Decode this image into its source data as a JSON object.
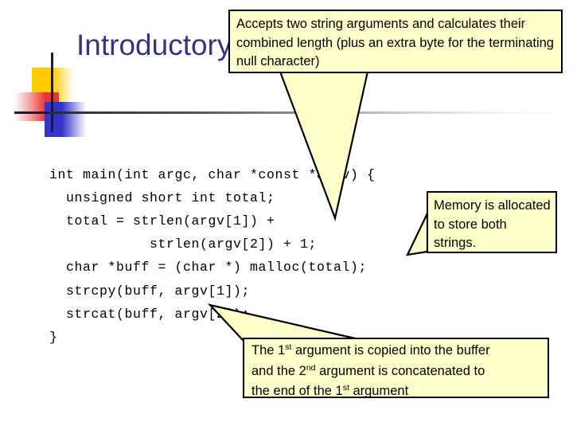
{
  "slide": {
    "title": "Introductory Example",
    "title_color": "#333388",
    "background": "#ffffff"
  },
  "logo": {
    "yellow": "#ffcc00",
    "red": "#ee3333",
    "blue": "#3333cc",
    "bar": "#1b1b33"
  },
  "code": {
    "language": "c",
    "text": "int main(int argc, char *const *argv) {\n  unsigned short int total;\n  total = strlen(argv[1]) +\n            strlen(argv[2]) + 1;\n  char *buff = (char *) malloc(total);\n  strcpy(buff, argv[1]);\n  strcat(buff, argv[2]);\n}"
  },
  "callouts": {
    "top": {
      "text": "Accepts two string arguments and calculates their combined length (plus an extra byte for the terminating null character)",
      "fill": "#ffffcc",
      "border": "#000000"
    },
    "memory": {
      "text": "Memory is allocated to store both strings.",
      "fill": "#ffffcc",
      "border": "#000000"
    },
    "bottom": {
      "line1_a": "The 1",
      "line1_sup": "st",
      "line1_b": " argument is copied into the buffer",
      "line2_a": "and the 2",
      "line2_sup": "nd",
      "line2_b": " argument is concatenated to",
      "line3_a": "the end of the 1",
      "line3_sup": "st",
      "line3_b": "  argument",
      "fill": "#ffffcc",
      "border": "#000000"
    }
  }
}
